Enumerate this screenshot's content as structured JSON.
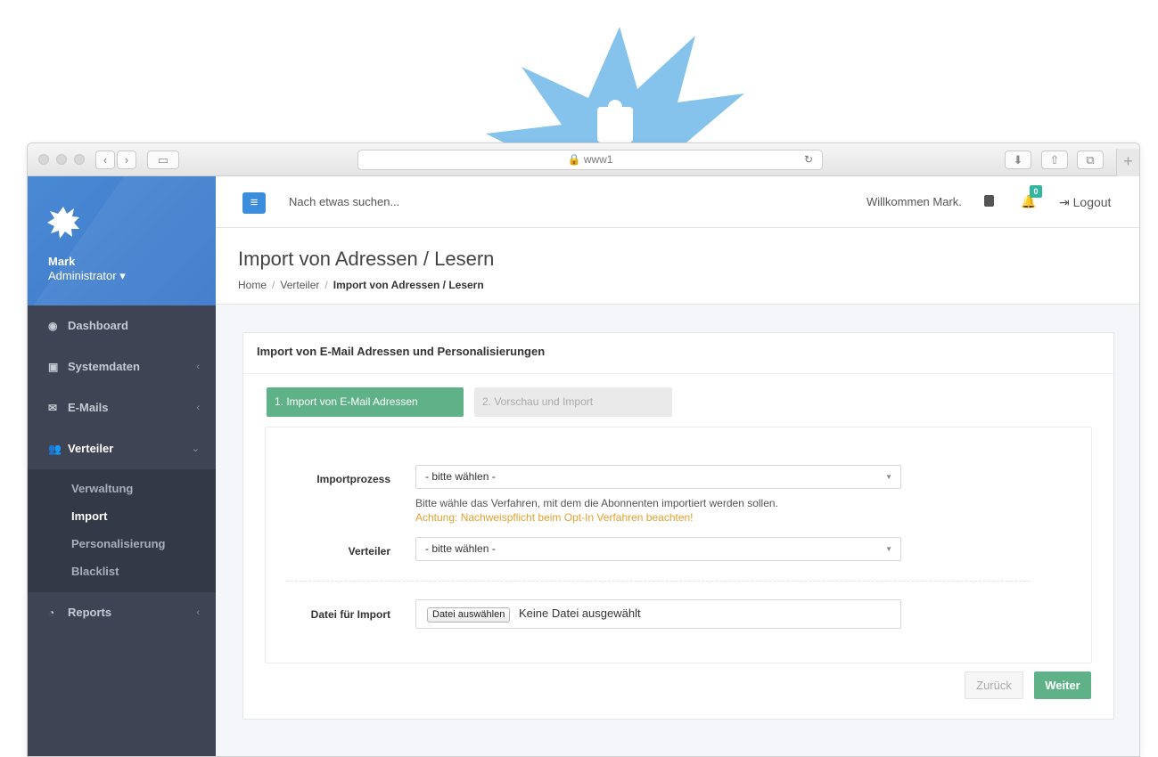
{
  "browser": {
    "url": "www1",
    "reload_icon": "↻"
  },
  "sidebar": {
    "user_name": "Mark",
    "user_role": "Administrator ▾",
    "items": [
      {
        "label": "Dashboard",
        "icon": "dashboard-icon",
        "chevron": ""
      },
      {
        "label": "Systemdaten",
        "icon": "systemdata-icon",
        "chevron": "‹"
      },
      {
        "label": "E-Mails",
        "icon": "envelope-icon",
        "chevron": "‹"
      },
      {
        "label": "Verteiler",
        "icon": "users-icon",
        "chevron": "⌄"
      },
      {
        "label": "Reports",
        "icon": "pie-chart-icon",
        "chevron": "‹"
      }
    ],
    "subitems": [
      "Verwaltung",
      "Import",
      "Personalisierung",
      "Blacklist"
    ]
  },
  "topbar": {
    "search_placeholder": "Nach etwas suchen...",
    "welcome": "Willkommen Mark.",
    "notification_count": "0",
    "logout": "Logout"
  },
  "page": {
    "title": "Import von Adressen / Lesern",
    "breadcrumb": [
      "Home",
      "Verteiler",
      "Import von Adressen / Lesern"
    ]
  },
  "card": {
    "title": "Import von E-Mail Adressen und Personalisierungen",
    "steps": [
      "1. Import von E-Mail Adressen",
      "2. Vorschau und Import"
    ],
    "form": {
      "importprozess_label": "Importprozess",
      "importprozess_value": "- bitte wählen -",
      "help_text": "Bitte wähle das Verfahren, mit dem die Abonnenten importiert werden sollen.",
      "warning_text": "Achtung: Nachweispflicht beim Opt-In Verfahren beachten!",
      "verteiler_label": "Verteiler",
      "verteiler_value": "- bitte wählen -",
      "file_label": "Datei für Import",
      "file_button": "Datei auswählen",
      "file_status": "Keine Datei ausgewählt"
    },
    "buttons": {
      "back": "Zurück",
      "next": "Weiter"
    }
  },
  "colors": {
    "sidebar_bg": "#3e4454",
    "profile_bg": "#4a89d4",
    "accent_green": "#5fb287",
    "warning": "#e5a02e",
    "badge_blue": "#86c3ec"
  }
}
